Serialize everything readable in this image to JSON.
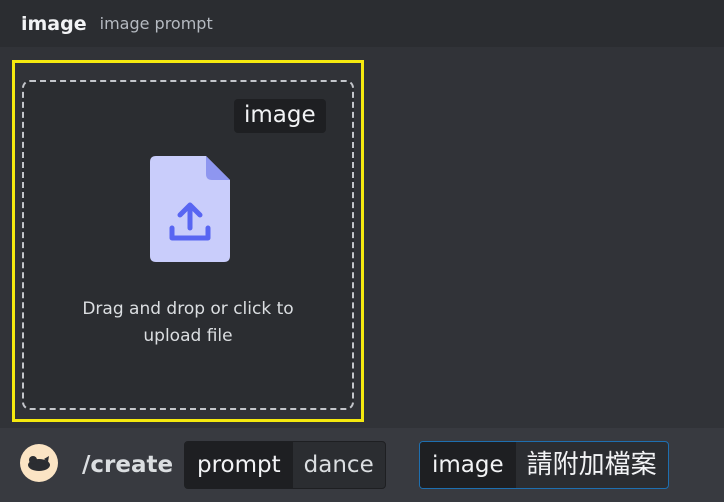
{
  "header": {
    "title": "image",
    "subtitle": "image prompt"
  },
  "upload": {
    "tag": "image",
    "instruction_line1": "Drag and drop or click to",
    "instruction_line2": "upload file",
    "icon": "upload-file-icon",
    "highlight_color": "#f5e90f"
  },
  "command": {
    "avatar_icon": "bot-avatar-icon",
    "name": "/create",
    "options": [
      {
        "name": "prompt",
        "value": "dance"
      },
      {
        "name": "image",
        "value": "請附加檔案"
      }
    ]
  },
  "colors": {
    "background": "#313338",
    "header": "#2b2d31",
    "accent_border": "#1e6fb0",
    "file_icon": "#c9cdfb",
    "file_icon_arrow": "#5865f2"
  }
}
